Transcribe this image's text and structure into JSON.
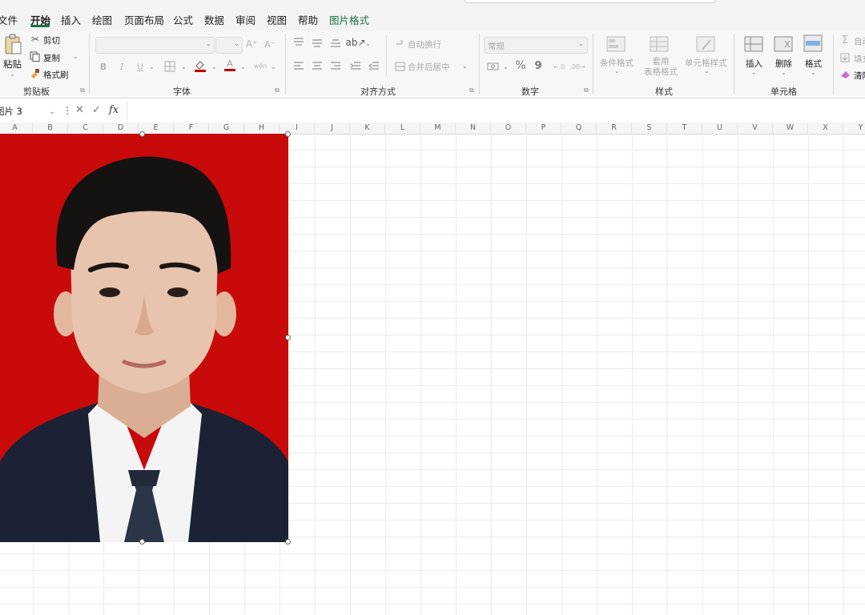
{
  "menu": {
    "items": [
      "文件",
      "开始",
      "插入",
      "绘图",
      "页面布局",
      "公式",
      "数据",
      "审阅",
      "视图",
      "帮助",
      "图片格式"
    ],
    "active": "开始"
  },
  "ribbon": {
    "clipboard": {
      "paste": "粘贴",
      "cut": "剪切",
      "copy": "复制",
      "format_painter": "格式刷",
      "group": "剪贴板"
    },
    "font": {
      "bold": "B",
      "italic": "I",
      "underline": "U",
      "grow": "A⁺",
      "shrink": "A⁻",
      "font_color": "A",
      "group": "字体"
    },
    "align": {
      "wrap": "自动换行",
      "merge": "合并后居中",
      "group": "对齐方式"
    },
    "number": {
      "format": "常规",
      "percent": "%",
      "comma": "9",
      "group": "数字"
    },
    "styles": {
      "conditional": "条件格式",
      "table_format": "套用\n表格格式",
      "cell_styles": "单元格样式",
      "group": "样式"
    },
    "cells": {
      "insert": "插入",
      "delete": "删除",
      "format": "格式",
      "group": "单元格"
    },
    "editing": {
      "autosum": "自动",
      "fill": "填充",
      "clear": "清除"
    }
  },
  "formula_bar": {
    "name_box": "图片 3",
    "fx": "fx",
    "cancel": "✕",
    "enter": "✓",
    "value": ""
  },
  "columns": [
    "A",
    "B",
    "C",
    "D",
    "E",
    "F",
    "G",
    "H",
    "I",
    "J",
    "K",
    "L",
    "M",
    "N",
    "O",
    "P",
    "Q",
    "R",
    "S",
    "T",
    "U",
    "V",
    "W",
    "X",
    "Y"
  ],
  "picture": {
    "description_colors": {
      "background": "#c80a0a",
      "suit": "#1c2233",
      "shirt": "#f4f4f4",
      "tie": "#2a3548",
      "skin": "#e8c3ad",
      "hair": "#151212"
    }
  }
}
